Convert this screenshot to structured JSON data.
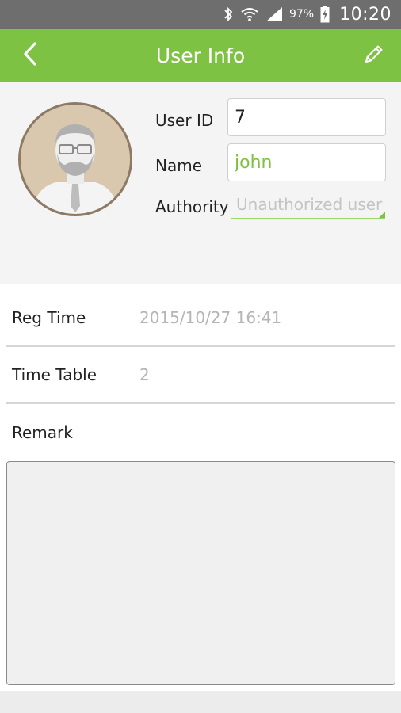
{
  "status_bar": {
    "battery_percent": "97%",
    "time": "10:20",
    "icons": [
      "bluetooth-icon",
      "wifi-icon",
      "signal-icon",
      "battery-charging-icon"
    ]
  },
  "app_bar": {
    "title": "User Info",
    "back_icon": "chevron-left-icon",
    "edit_icon": "pencil-icon",
    "color": "#7dc242"
  },
  "profile": {
    "avatar_icon": "user-avatar-icon",
    "user_id_label": "User ID",
    "user_id_value": "7",
    "name_label": "Name",
    "name_value": "john",
    "authority_label": "Authority",
    "authority_value": "Unauthorized user"
  },
  "details": {
    "reg_time_label": "Reg Time",
    "reg_time_value": "2015/10/27 16:41",
    "time_table_label": "Time Table",
    "time_table_value": "2",
    "remark_label": "Remark",
    "remark_value": ""
  }
}
